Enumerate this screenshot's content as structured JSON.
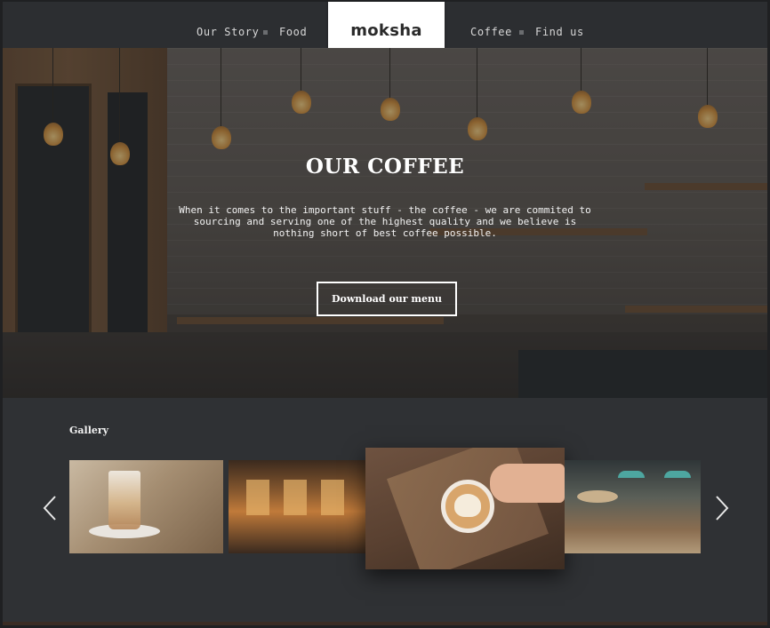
{
  "nav": {
    "items": [
      {
        "label": "Our Story"
      },
      {
        "label": "Food"
      },
      {
        "label": "Coffee"
      },
      {
        "label": "Find us"
      }
    ],
    "logo": "moksha"
  },
  "hero": {
    "title": "OUR COFFEE",
    "text": "When it comes to the important stuff - the coffee - we are commited to sourcing and serving one of the highest quality and we believe is nothing short of best coffee possible.",
    "button_label": "Download our menu"
  },
  "gallery": {
    "title": "Gallery",
    "prev_icon": "chevron-left-icon",
    "next_icon": "chevron-right-icon"
  },
  "colors": {
    "background": "#2f3134",
    "nav": "#2c2e31",
    "logo_box": "#ffffff",
    "text": "#ffffff"
  }
}
